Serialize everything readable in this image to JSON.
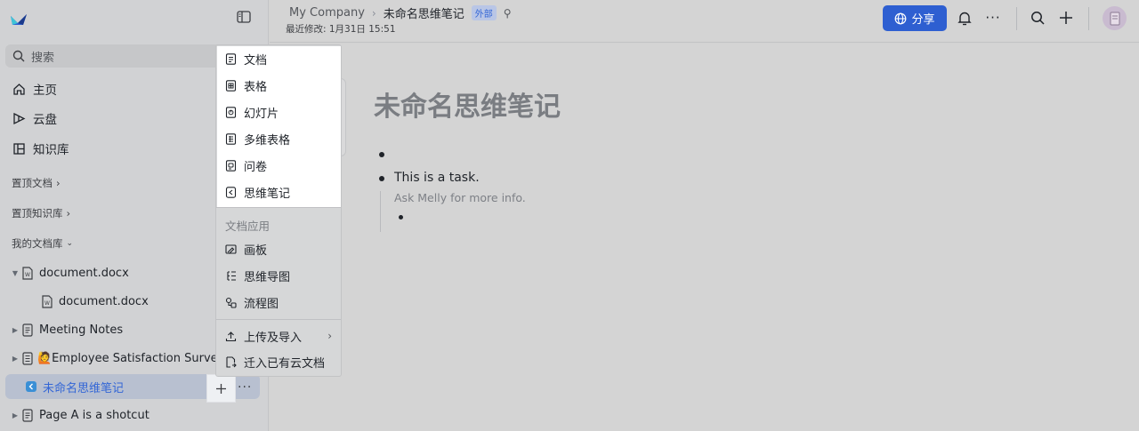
{
  "sidebar": {
    "search_label": "搜索",
    "nav": [
      {
        "label": "主页",
        "icon": "home-icon"
      },
      {
        "label": "云盘",
        "icon": "cloud-drive-icon"
      },
      {
        "label": "知识库",
        "icon": "wiki-icon"
      }
    ],
    "sections": {
      "pinned_docs": "置顶文档",
      "pinned_wiki": "置顶知识库",
      "my_library": "我的文档库"
    },
    "tree": [
      {
        "label": "document.docx",
        "caret": "down",
        "icon": "word-doc-icon"
      },
      {
        "label": "document.docx",
        "caret": "",
        "icon": "word-doc-icon"
      },
      {
        "label": "Meeting Notes",
        "caret": "right",
        "icon": "doc-icon"
      },
      {
        "label": "🙋Employee Satisfaction Survey",
        "caret": "right",
        "icon": "survey-icon"
      },
      {
        "label": "未命名思维笔记",
        "caret": "",
        "icon": "mind-note-icon",
        "active": true
      },
      {
        "label": "Page A is a shotcut",
        "caret": "right",
        "icon": "doc-icon"
      }
    ]
  },
  "header": {
    "company": "My Company",
    "doc_name": "未命名思维笔记",
    "badge": "外部",
    "last_modified": "最近修改: 1月31日 15:51",
    "share_label": "分享"
  },
  "document": {
    "title": "未命名思维笔记",
    "task": "This is a task.",
    "hint": "Ask Melly for more info."
  },
  "menu": {
    "items": [
      {
        "label": "文档",
        "icon": "doc-icon"
      },
      {
        "label": "表格",
        "icon": "sheet-icon"
      },
      {
        "label": "幻灯片",
        "icon": "slides-icon"
      },
      {
        "label": "多维表格",
        "icon": "base-icon"
      },
      {
        "label": "问卷",
        "icon": "form-icon"
      },
      {
        "label": "思维笔记",
        "icon": "mind-note-icon"
      }
    ],
    "apps_header": "文档应用",
    "apps": [
      {
        "label": "画板",
        "icon": "whiteboard-icon"
      },
      {
        "label": "思维导图",
        "icon": "mindmap-icon"
      },
      {
        "label": "流程图",
        "icon": "flowchart-icon"
      }
    ],
    "upload": "上传及导入",
    "move_in": "迁入已有云文档"
  },
  "colors": {
    "accent": "#2e5fd1",
    "active_text": "#3366d6"
  }
}
